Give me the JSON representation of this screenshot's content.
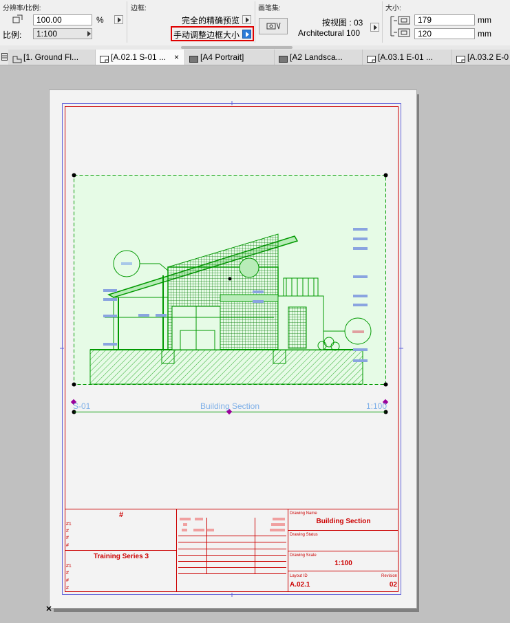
{
  "infobox": {
    "resolution_scale": {
      "title": "分辨率/比例:",
      "resolution_value": "100.00",
      "percent_unit": "%",
      "scale_label": "比例:",
      "scale_value": "1:100"
    },
    "frame": {
      "title": "边框:",
      "option_exact_preview": "完全的精确预览",
      "option_manual_resize": "手动调整边框大小"
    },
    "pen_set": {
      "title": "画笔集:",
      "view_label": "按视图 : 03",
      "pen_set_name": "Architectural 100"
    },
    "size": {
      "title": "大小:",
      "width_value": "179",
      "height_value": "120",
      "unit": "mm"
    }
  },
  "tabs": [
    {
      "label": "[1. Ground Fl...",
      "active": false,
      "icon": "floor-plan-icon"
    },
    {
      "label": "[A.02.1 S-01 ...",
      "active": true,
      "icon": "layout-icon"
    },
    {
      "label": "[A4 Portrait]",
      "active": false,
      "icon": "master-layout-icon"
    },
    {
      "label": "[A2 Landsca...",
      "active": false,
      "icon": "master-layout-icon"
    },
    {
      "label": "[A.03.1 E-01 ...",
      "active": false,
      "icon": "layout-icon"
    },
    {
      "label": "[A.03.2 E-0",
      "active": false,
      "icon": "layout-icon"
    }
  ],
  "drawing": {
    "id": "S-01",
    "name": "Building Section",
    "scale": "1:100"
  },
  "title_block": {
    "hash_header": "#",
    "series_name": "Training Series 3",
    "hash_items": [
      "#1",
      "#",
      "#",
      "#"
    ],
    "hash_items_2": [
      "#1",
      "#",
      "#",
      "#"
    ],
    "drawing_name_label": "Drawing Name",
    "drawing_name_value": "Building Section",
    "drawing_status_label": "Drawing Status",
    "drawing_scale_label": "Drawing Scale",
    "drawing_scale_value": "1:100",
    "layout_id_label": "Layout ID",
    "layout_id_value": "A.02.1",
    "revision_label": "Revision",
    "revision_value": "02"
  },
  "colors": {
    "red": "#cc0000",
    "green": "#009900",
    "green_fill": "#e6fbe6",
    "blue_tag": "#8aa4e0",
    "light_blue_text": "#7fb0e8",
    "selection_blue": "#5050e0"
  }
}
